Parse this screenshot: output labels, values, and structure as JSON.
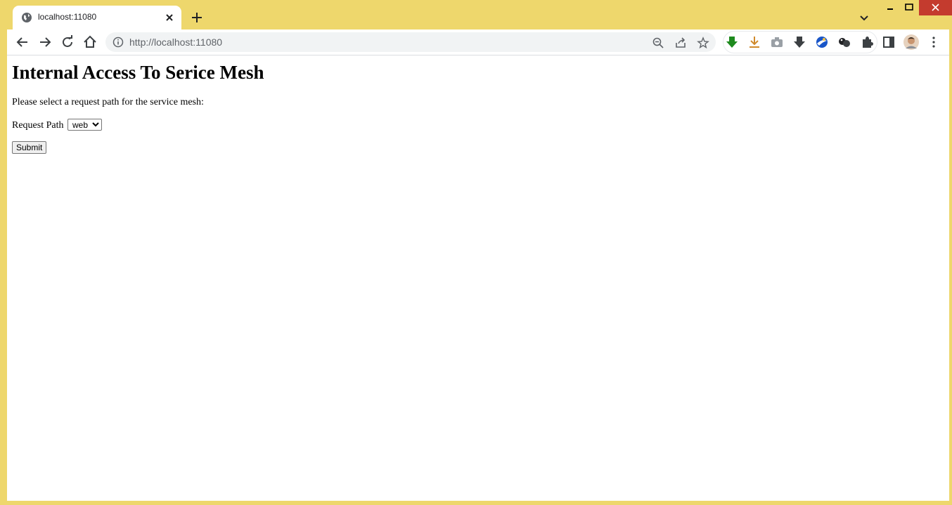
{
  "browser": {
    "tab": {
      "title": "localhost:11080",
      "favicon": "globe-icon"
    },
    "address_bar": {
      "url": "http://localhost:11080"
    },
    "theme_color": "#EED76C",
    "close_color": "#C43B2E"
  },
  "page": {
    "heading": "Internal Access To Serice Mesh",
    "intro": "Please select a request path for the service mesh:",
    "request_path": {
      "label": "Request Path",
      "selected": "web",
      "options": [
        "web"
      ]
    },
    "submit_label": "Submit"
  }
}
